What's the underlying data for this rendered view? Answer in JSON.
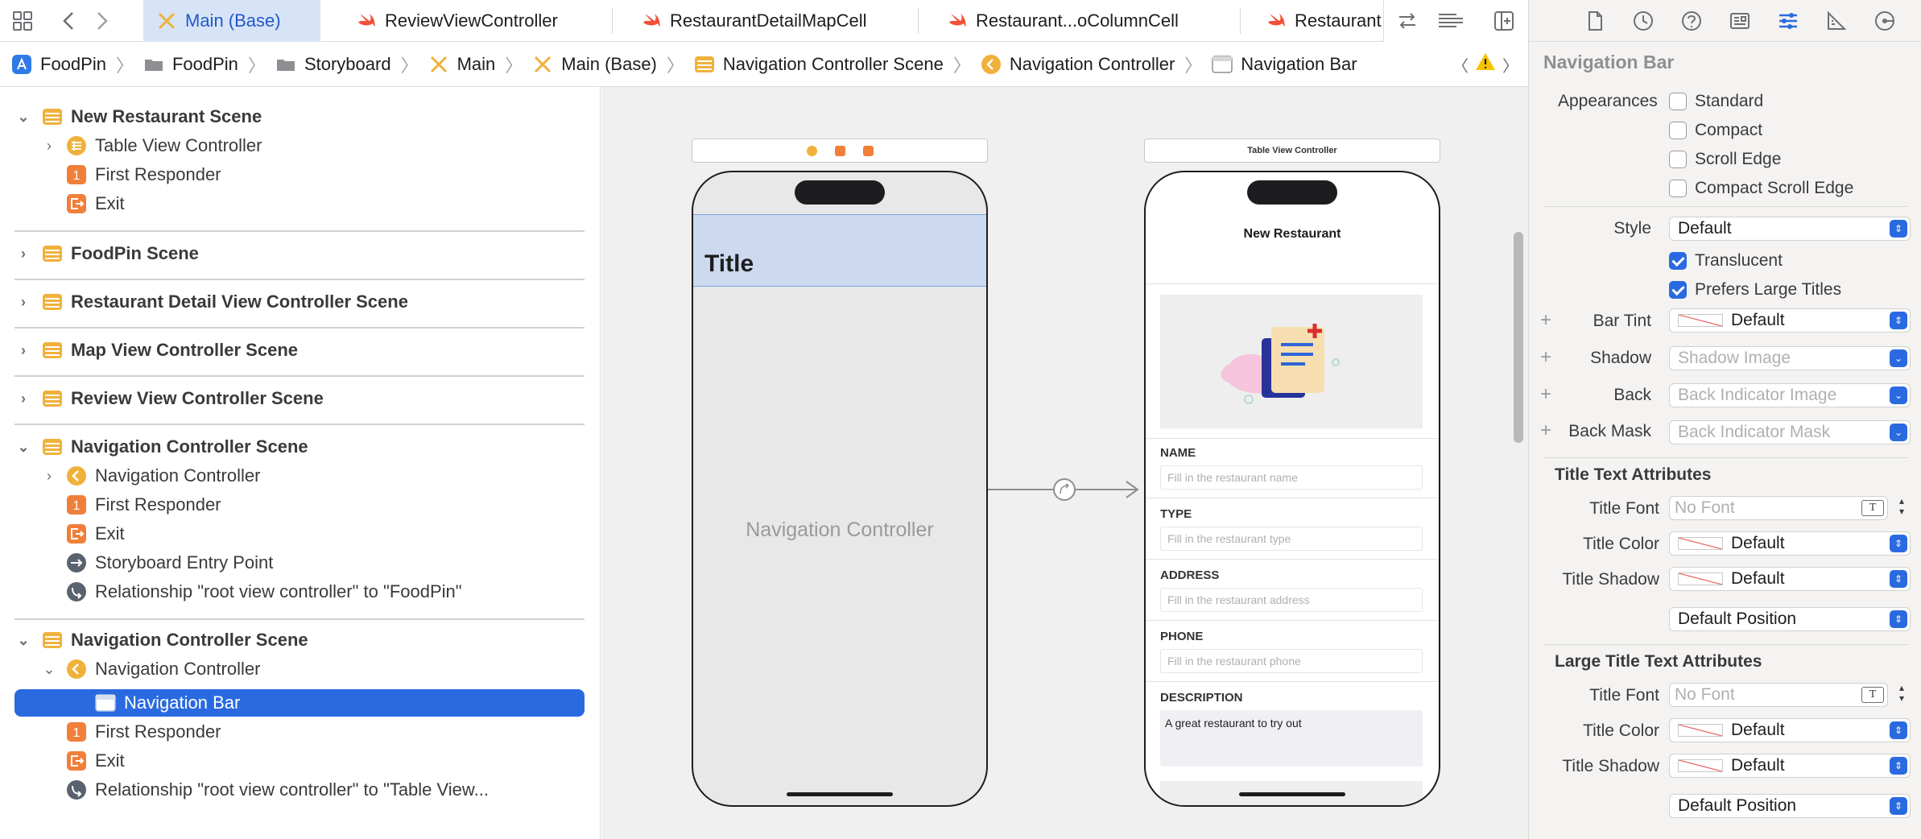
{
  "tabs": [
    {
      "label": "Main (Base)",
      "icon": "storyboard-icon",
      "active": true
    },
    {
      "label": "ReviewViewController",
      "icon": "swift-icon"
    },
    {
      "label": "RestaurantDetailMapCell",
      "icon": "swift-icon"
    },
    {
      "label": "Restaurant...oColumnCell",
      "icon": "swift-icon"
    },
    {
      "label": "Restaurant",
      "icon": "swift-icon"
    }
  ],
  "breadcrumb": [
    {
      "label": "FoodPin",
      "icon": "app-icon"
    },
    {
      "label": "FoodPin",
      "icon": "folder-icon"
    },
    {
      "label": "Storyboard",
      "icon": "folder-icon"
    },
    {
      "label": "Main",
      "icon": "storyboard-icon"
    },
    {
      "label": "Main (Base)",
      "icon": "storyboard-icon"
    },
    {
      "label": "Navigation Controller Scene",
      "icon": "scene-icon"
    },
    {
      "label": "Navigation Controller",
      "icon": "nav-controller-icon"
    },
    {
      "label": "Navigation Bar",
      "icon": "nav-bar-icon"
    }
  ],
  "outline": [
    {
      "label": "New Restaurant Scene",
      "type": "scene",
      "expanded": true,
      "icon": "scene-icon"
    },
    {
      "label": "Table View Controller",
      "icon": "table-view-controller-icon",
      "collapsed": true
    },
    {
      "label": "First Responder",
      "icon": "first-responder-icon"
    },
    {
      "label": "Exit",
      "icon": "exit-icon"
    },
    {
      "label": "FoodPin Scene",
      "type": "scene",
      "icon": "scene-icon"
    },
    {
      "label": "Restaurant Detail View Controller Scene",
      "type": "scene",
      "icon": "scene-icon"
    },
    {
      "label": "Map View Controller Scene",
      "type": "scene",
      "icon": "scene-icon"
    },
    {
      "label": "Review View Controller Scene",
      "type": "scene",
      "icon": "scene-icon"
    },
    {
      "label": "Navigation Controller Scene",
      "type": "scene",
      "expanded": true,
      "icon": "scene-icon"
    },
    {
      "label": "Navigation Controller",
      "icon": "nav-controller-icon",
      "collapsed": true
    },
    {
      "label": "First Responder",
      "icon": "first-responder-icon"
    },
    {
      "label": "Exit",
      "icon": "exit-icon"
    },
    {
      "label": "Storyboard Entry Point",
      "icon": "entry-point-icon"
    },
    {
      "label": "Relationship \"root view controller\" to \"FoodPin\"",
      "icon": "relationship-icon"
    },
    {
      "label": "Navigation Controller Scene",
      "type": "scene",
      "expanded": true,
      "icon": "scene-icon"
    },
    {
      "label": "Navigation Controller",
      "icon": "nav-controller-icon",
      "expanded": true
    },
    {
      "label": "Navigation Bar",
      "icon": "nav-bar-icon",
      "selected": true
    },
    {
      "label": "First Responder",
      "icon": "first-responder-icon"
    },
    {
      "label": "Exit",
      "icon": "exit-icon"
    },
    {
      "label": "Relationship \"root view controller\" to \"Table View...",
      "icon": "relationship-icon"
    }
  ],
  "canvas": {
    "nav_scene": {
      "nav_title": "Title",
      "center_label": "Navigation Controller"
    },
    "table_scene": {
      "header": "Table View Controller",
      "nav_title": "New Restaurant",
      "fields": [
        {
          "label": "NAME",
          "placeholder": "Fill in the restaurant name"
        },
        {
          "label": "TYPE",
          "placeholder": "Fill in the restaurant type"
        },
        {
          "label": "ADDRESS",
          "placeholder": "Fill in the restaurant address"
        },
        {
          "label": "PHONE",
          "placeholder": "Fill in the restaurant phone"
        }
      ],
      "description_label": "DESCRIPTION",
      "description_value": "A great restaurant to try out"
    }
  },
  "inspector": {
    "title": "Navigation Bar",
    "appearances_label": "Appearances",
    "appearances": [
      {
        "label": "Standard",
        "checked": false
      },
      {
        "label": "Compact",
        "checked": false
      },
      {
        "label": "Scroll Edge",
        "checked": false
      },
      {
        "label": "Compact Scroll Edge",
        "checked": false
      }
    ],
    "style_label": "Style",
    "style_value": "Default",
    "translucent": {
      "label": "Translucent",
      "checked": true
    },
    "prefers_large_titles": {
      "label": "Prefers Large Titles",
      "checked": true
    },
    "bar_tint": {
      "label": "Bar Tint",
      "value": "Default"
    },
    "shadow": {
      "label": "Shadow",
      "placeholder": "Shadow Image"
    },
    "back": {
      "label": "Back",
      "placeholder": "Back Indicator Image"
    },
    "back_mask": {
      "label": "Back Mask",
      "placeholder": "Back Indicator Mask"
    },
    "title_text": {
      "heading": "Title Text Attributes",
      "font_label": "Title Font",
      "font_placeholder": "No Font",
      "color_label": "Title Color",
      "color_value": "Default",
      "shadow_label": "Title Shadow",
      "shadow_value": "Default",
      "position_value": "Default Position"
    },
    "large_title_text": {
      "heading": "Large Title Text Attributes",
      "font_label": "Title Font",
      "font_placeholder": "No Font",
      "color_label": "Title Color",
      "color_value": "Default",
      "shadow_label": "Title Shadow",
      "shadow_value": "Default",
      "position_value": "Default Position"
    }
  },
  "colors": {
    "accent": "#2a6ae0",
    "selection": "#2a6ae0",
    "active_tab": "#d7e4f7",
    "scene_icon": "#f0b13b",
    "first_responder": "#f07f3a",
    "swift": "#f05138"
  }
}
